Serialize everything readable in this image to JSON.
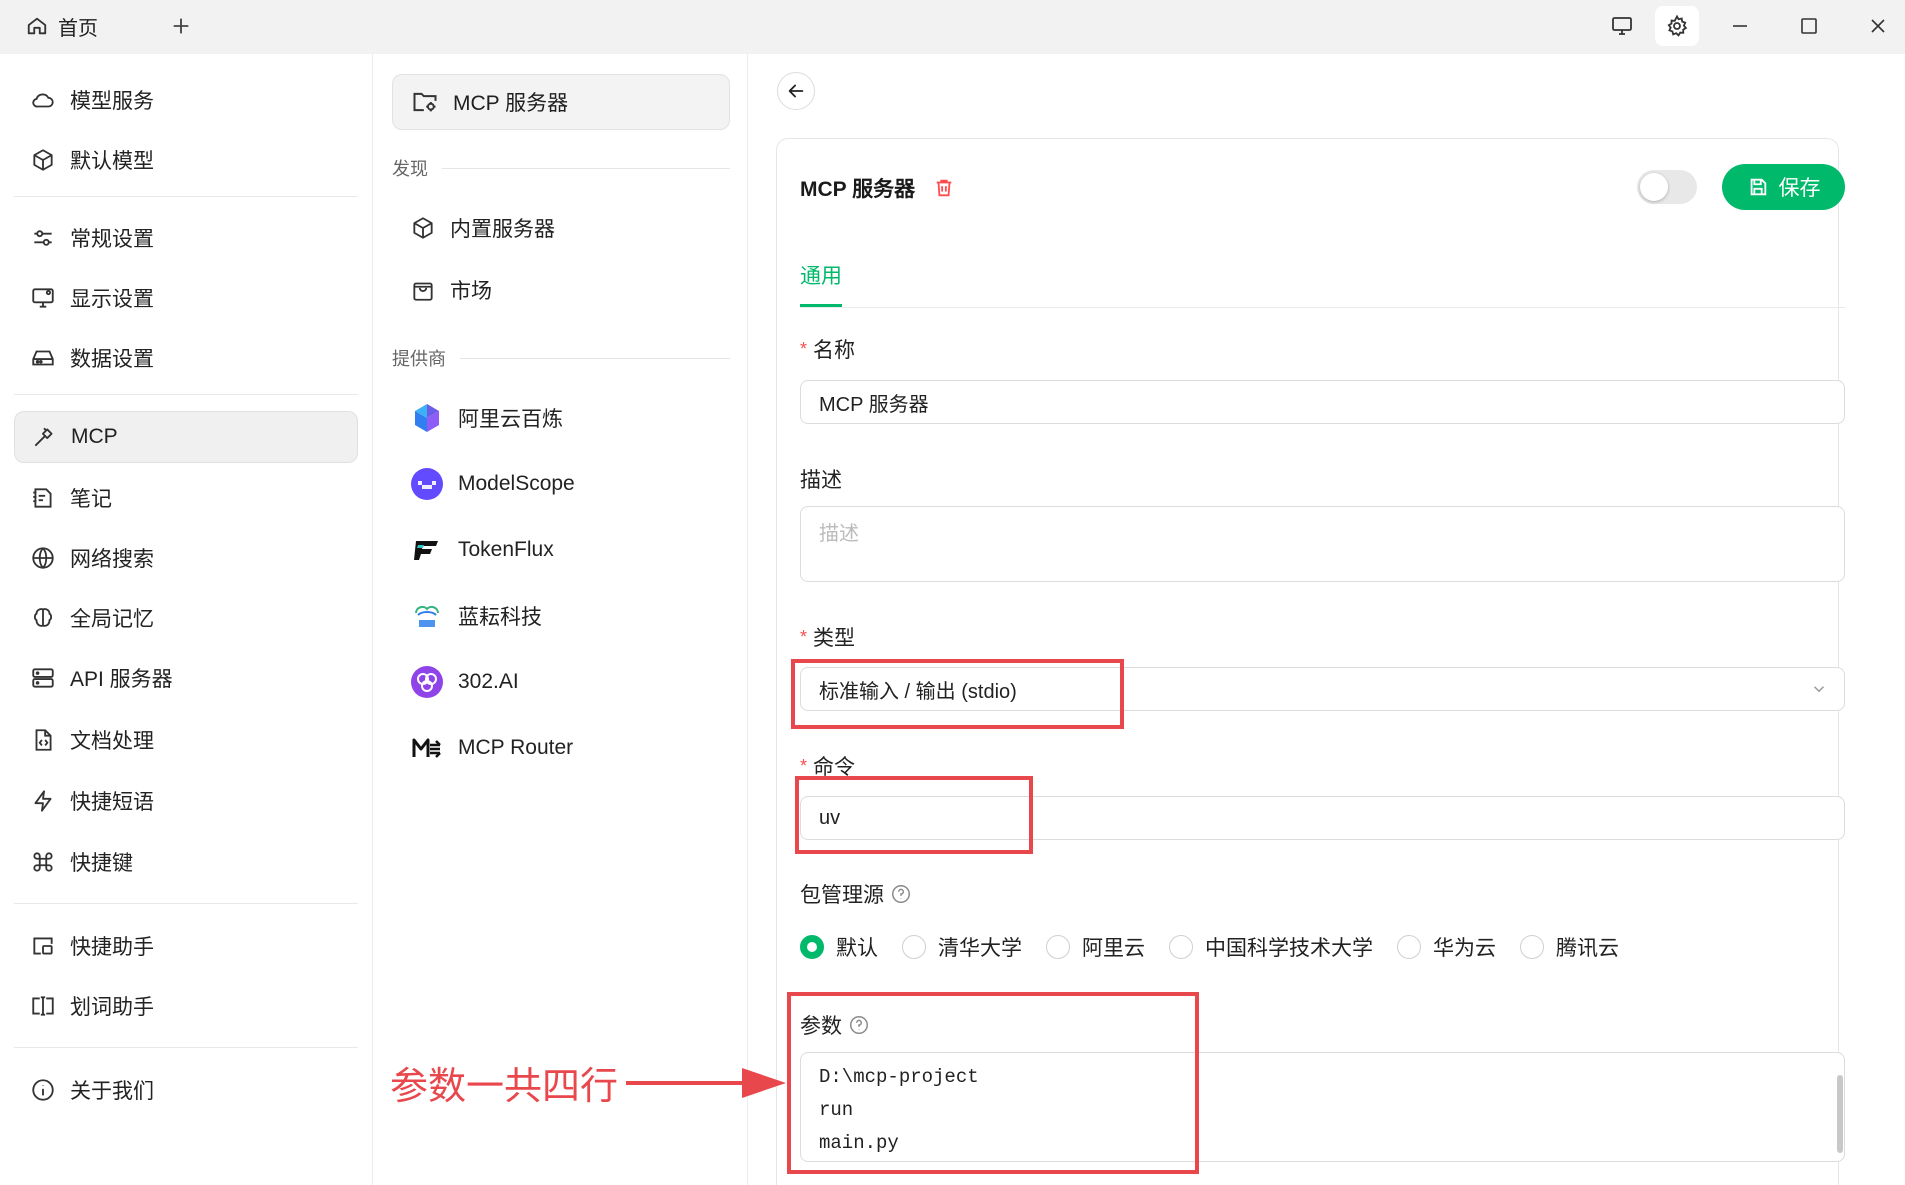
{
  "titlebar": {
    "home_tab": "首页",
    "icons": [
      "home-icon",
      "plus-icon",
      "monitor-icon",
      "gear-icon",
      "minimize-icon",
      "maximize-icon",
      "close-icon"
    ]
  },
  "nav": {
    "items": [
      {
        "label": "模型服务",
        "icon": "cloud-icon"
      },
      {
        "label": "默认模型",
        "icon": "cube-icon"
      },
      {
        "label": "常规设置",
        "icon": "sliders-icon"
      },
      {
        "label": "显示设置",
        "icon": "display-icon"
      },
      {
        "label": "数据设置",
        "icon": "drive-icon"
      },
      {
        "label": "MCP",
        "icon": "hammer-icon",
        "active": true
      },
      {
        "label": "笔记",
        "icon": "note-icon"
      },
      {
        "label": "网络搜索",
        "icon": "globe-icon"
      },
      {
        "label": "全局记忆",
        "icon": "brain-icon"
      },
      {
        "label": "API 服务器",
        "icon": "server-icon"
      },
      {
        "label": "文档处理",
        "icon": "file-code-icon"
      },
      {
        "label": "快捷短语",
        "icon": "zap-icon"
      },
      {
        "label": "快捷键",
        "icon": "command-icon"
      },
      {
        "label": "快捷助手",
        "icon": "window-icon"
      },
      {
        "label": "划词助手",
        "icon": "text-cursor-icon"
      },
      {
        "label": "关于我们",
        "icon": "info-icon"
      }
    ]
  },
  "mid": {
    "active_label": "MCP 服务器",
    "section_discover": "发现",
    "discover_items": [
      {
        "label": "内置服务器",
        "icon": "package-icon"
      },
      {
        "label": "市场",
        "icon": "shopping-bag-icon"
      }
    ],
    "section_providers": "提供商",
    "providers": [
      {
        "label": "阿里云百炼",
        "icon": "aliyun-bailian-logo"
      },
      {
        "label": "ModelScope",
        "icon": "modelscope-logo"
      },
      {
        "label": "TokenFlux",
        "icon": "tokenflux-logo"
      },
      {
        "label": "蓝耘科技",
        "icon": "lanyun-logo"
      },
      {
        "label": "302.AI",
        "icon": "302ai-logo"
      },
      {
        "label": "MCP Router",
        "icon": "mcp-router-logo"
      }
    ]
  },
  "panel": {
    "title": "MCP 服务器",
    "save_label": "保存",
    "enabled": false,
    "tab_general": "通用",
    "name_label": "名称",
    "name_value": "MCP 服务器",
    "desc_label": "描述",
    "desc_placeholder": "描述",
    "type_label": "类型",
    "type_value": "标准输入 / 输出 (stdio)",
    "command_label": "命令",
    "command_value": "uv",
    "registry_label": "包管理源",
    "registry_options": [
      "默认",
      "清华大学",
      "阿里云",
      "中国科学技术大学",
      "华为云",
      "腾讯云"
    ],
    "registry_selected": "默认",
    "args_label": "参数",
    "args_lines": [
      "D:\\mcp-project",
      "run",
      "main.py"
    ]
  },
  "annotation": {
    "text": "参数一共四行"
  },
  "colors": {
    "accent": "#00b96b",
    "annotation_red": "#e8474c",
    "required": "#ff4d4f"
  }
}
